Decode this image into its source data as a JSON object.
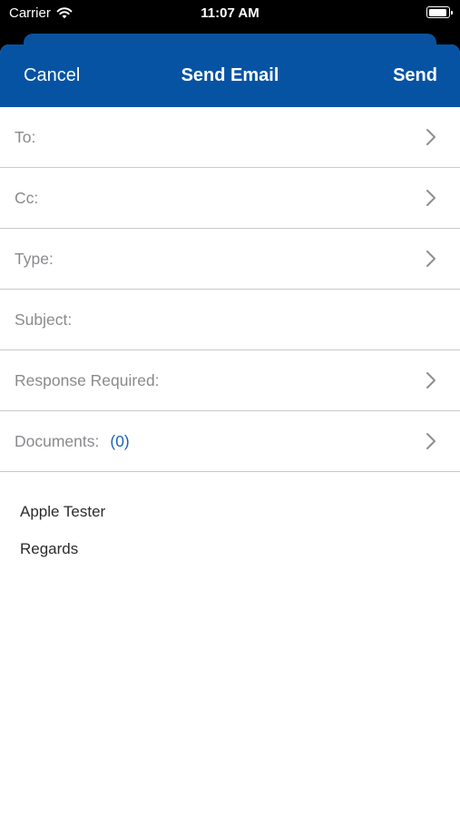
{
  "status_bar": {
    "carrier": "Carrier",
    "time": "11:07 AM"
  },
  "nav": {
    "cancel_label": "Cancel",
    "title": "Send Email",
    "send_label": "Send"
  },
  "form": {
    "rows": [
      {
        "label": "To:",
        "has_chevron": true
      },
      {
        "label": "Cc:",
        "has_chevron": true
      },
      {
        "label": "Type:",
        "has_chevron": true
      },
      {
        "label": "Subject:",
        "has_chevron": false
      },
      {
        "label": "Response Required:",
        "has_chevron": true
      },
      {
        "label": "Documents:",
        "count": "(0)",
        "has_chevron": true
      }
    ]
  },
  "body": {
    "lines": [
      "Apple Tester",
      "Regards"
    ]
  },
  "colors": {
    "nav_blue": "#0653a4",
    "link_blue": "#1a66b0",
    "label_gray": "#8a8a8e"
  }
}
